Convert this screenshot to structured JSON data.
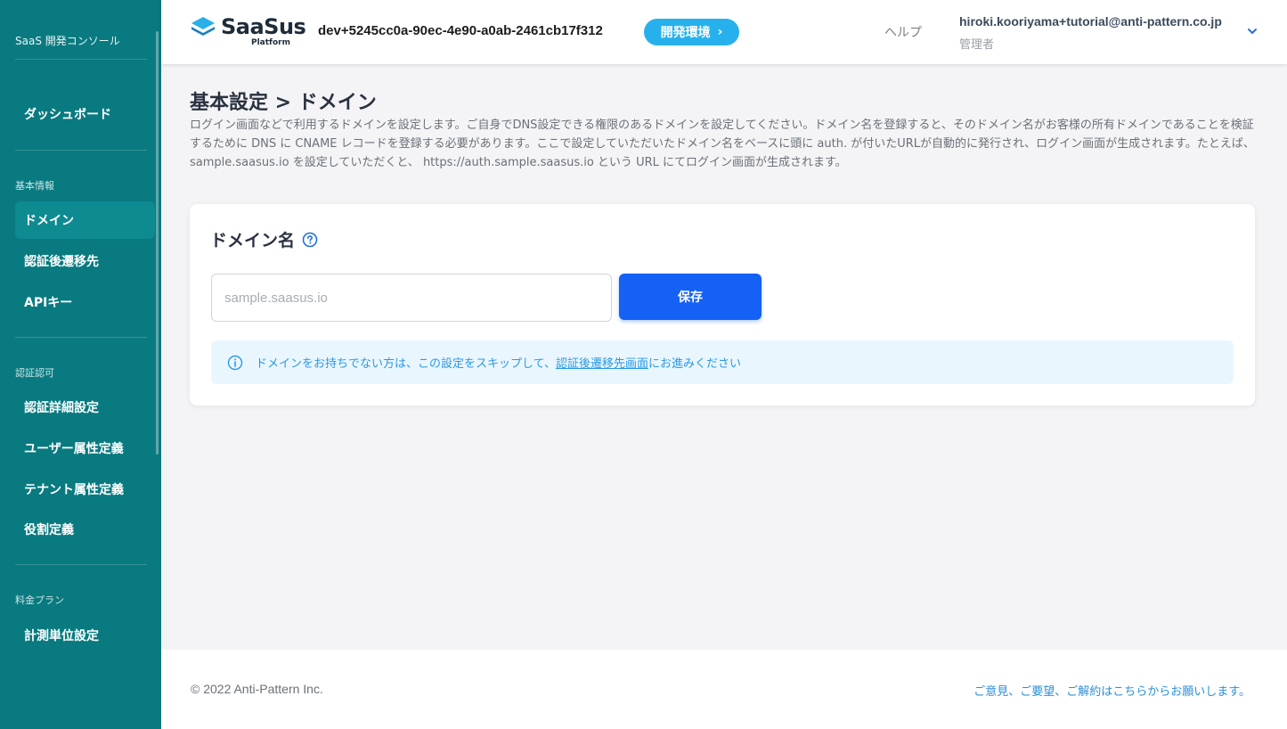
{
  "sidebar": {
    "console_title": "SaaS 開発コンソール",
    "dashboard": "ダッシュボード",
    "section_basic": "基本情報",
    "item_domain": "ドメイン",
    "item_redirect": "認証後遷移先",
    "item_apikey": "APIキー",
    "section_auth": "認証認可",
    "item_auth_detail": "認証詳細設定",
    "item_user_attr": "ユーザー属性定義",
    "item_tenant_attr": "テナント属性定義",
    "item_role": "役割定義",
    "section_pricing": "料金プラン",
    "item_metering": "計測単位設定"
  },
  "header": {
    "logo_text": "SaaSus",
    "logo_sub": "Platform",
    "env_id": "dev+5245cc0a-90ec-4e90-a0ab-2461cb17f312",
    "env_badge": "開発環境",
    "env_badge_icon": "chevron-right-icon",
    "help": "ヘルプ",
    "user_email": "hiroki.kooriyama+tutorial@anti-pattern.co.jp",
    "user_role": "管理者",
    "user_menu_icon": "chevron-down-icon"
  },
  "main": {
    "title": "基本設定 > ドメイン",
    "description": "ログイン画面などで利用するドメインを設定します。ご自身でDNS設定できる権限のあるドメインを設定してください。ドメイン名を登録すると、そのドメイン名がお客様の所有ドメインであることを検証するために DNS に CNAME レコードを登録する必要があります。ここで設定していただいたドメイン名をベースに頭に auth. が付いたURLが自動的に発行され、ログイン画面が生成されます。たとえば、 sample.saasus.io を設定していただくと、 https://auth.sample.saasus.io という URL にてログイン画面が生成されます。",
    "card": {
      "title": "ドメイン名",
      "input_placeholder": "sample.saasus.io",
      "input_value": "",
      "save_label": "保存",
      "info_text_before": "ドメインをお持ちでない方は、この設定をスキップして、",
      "info_link": "認証後遷移先画面",
      "info_text_after": "にお進みください"
    }
  },
  "footer": {
    "copyright": "© 2022 Anti-Pattern Inc.",
    "feedback_link": "ご意見、ご要望、ご解約はこちらからお願いします。"
  },
  "colors": {
    "sidebar_bg": "#097a80",
    "accent_blue": "#1560f5",
    "badge_blue": "#27b1ec",
    "info_bg": "#eaf6fd"
  }
}
